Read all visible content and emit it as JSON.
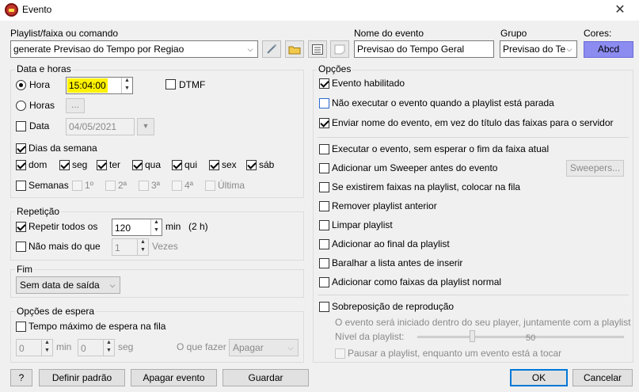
{
  "window": {
    "title": "Evento",
    "close_glyph": "✕"
  },
  "playlist": {
    "label": "Playlist/faixa ou comando",
    "value": "generate Previsao do Tempo por Regiao",
    "event_name_label": "Nome do evento",
    "event_name_value": "Previsao do Tempo Geral",
    "group_label": "Grupo",
    "group_value": "Previsao do Te",
    "colors_label": "Cores:",
    "colors_button": "Abcd",
    "colors_accent": "#8b8bf0"
  },
  "datetime": {
    "legend": "Data e horas",
    "hora_label": "Hora",
    "hora_value": "15:04:00",
    "highlight_color": "#fff200",
    "dtmf_label": "DTMF",
    "horas_label": "Horas",
    "horas_button": "...",
    "data_label": "Data",
    "data_value": "04/05/2021",
    "weekdays_label": "Dias da semana",
    "days": [
      "dom",
      "seg",
      "ter",
      "qua",
      "qui",
      "sex",
      "sáb"
    ],
    "semanas_label": "Semanas",
    "weeks": [
      "1º",
      "2ª",
      "3ª",
      "4ª",
      "Última"
    ]
  },
  "repeat": {
    "legend": "Repetição",
    "every_label": "Repetir todos os",
    "every_value": "120",
    "every_unit": "min",
    "every_hint": "(2 h)",
    "max_label": "Não mais do que",
    "max_value": "1",
    "max_unit": "Vezes"
  },
  "end": {
    "legend": "Fim",
    "value": "Sem data de saída"
  },
  "wait": {
    "legend": "Opções de espera",
    "max_wait_label": "Tempo máximo de espera na fila",
    "min_value": "0",
    "min_unit": "min",
    "seg_value": "0",
    "seg_unit": "seg",
    "action_label": "O que fazer",
    "action_value": "Apagar"
  },
  "options": {
    "legend": "Opções",
    "items": [
      {
        "label": "Evento habilitado",
        "checked": true
      },
      {
        "label": "Não executar o evento quando a playlist está parada",
        "checked": false
      },
      {
        "label": "Enviar nome do evento, em vez do título das faixas para o servidor",
        "checked": true
      },
      {
        "label": "Executar o evento, sem esperar o fim da faixa atual",
        "checked": false
      },
      {
        "label": "Adicionar um Sweeper antes do evento",
        "checked": false
      },
      {
        "label": "Se existirem faixas na playlist, colocar na fila",
        "checked": false
      },
      {
        "label": "Remover playlist anterior",
        "checked": false
      },
      {
        "label": "Limpar playlist",
        "checked": false
      },
      {
        "label": "Adicionar ao final da playlist",
        "checked": false
      },
      {
        "label": "Baralhar a lista antes de inserir",
        "checked": false
      },
      {
        "label": "Adicionar como faixas da playlist normal",
        "checked": false
      },
      {
        "label": "Sobreposição de reprodução",
        "checked": false
      }
    ],
    "sweepers_button": "Sweepers...",
    "overlap_note": "O evento será iniciado dentro do seu player, juntamente com a playlist",
    "level_label": "Nível da playlist:",
    "level_value": "50",
    "pause_label": "Pausar a playlist, enquanto um evento está a tocar"
  },
  "footer": {
    "help": "?",
    "defaults": "Definir padrão",
    "delete": "Apagar evento",
    "save": "Guardar",
    "ok": "OK",
    "cancel": "Cancelar"
  }
}
